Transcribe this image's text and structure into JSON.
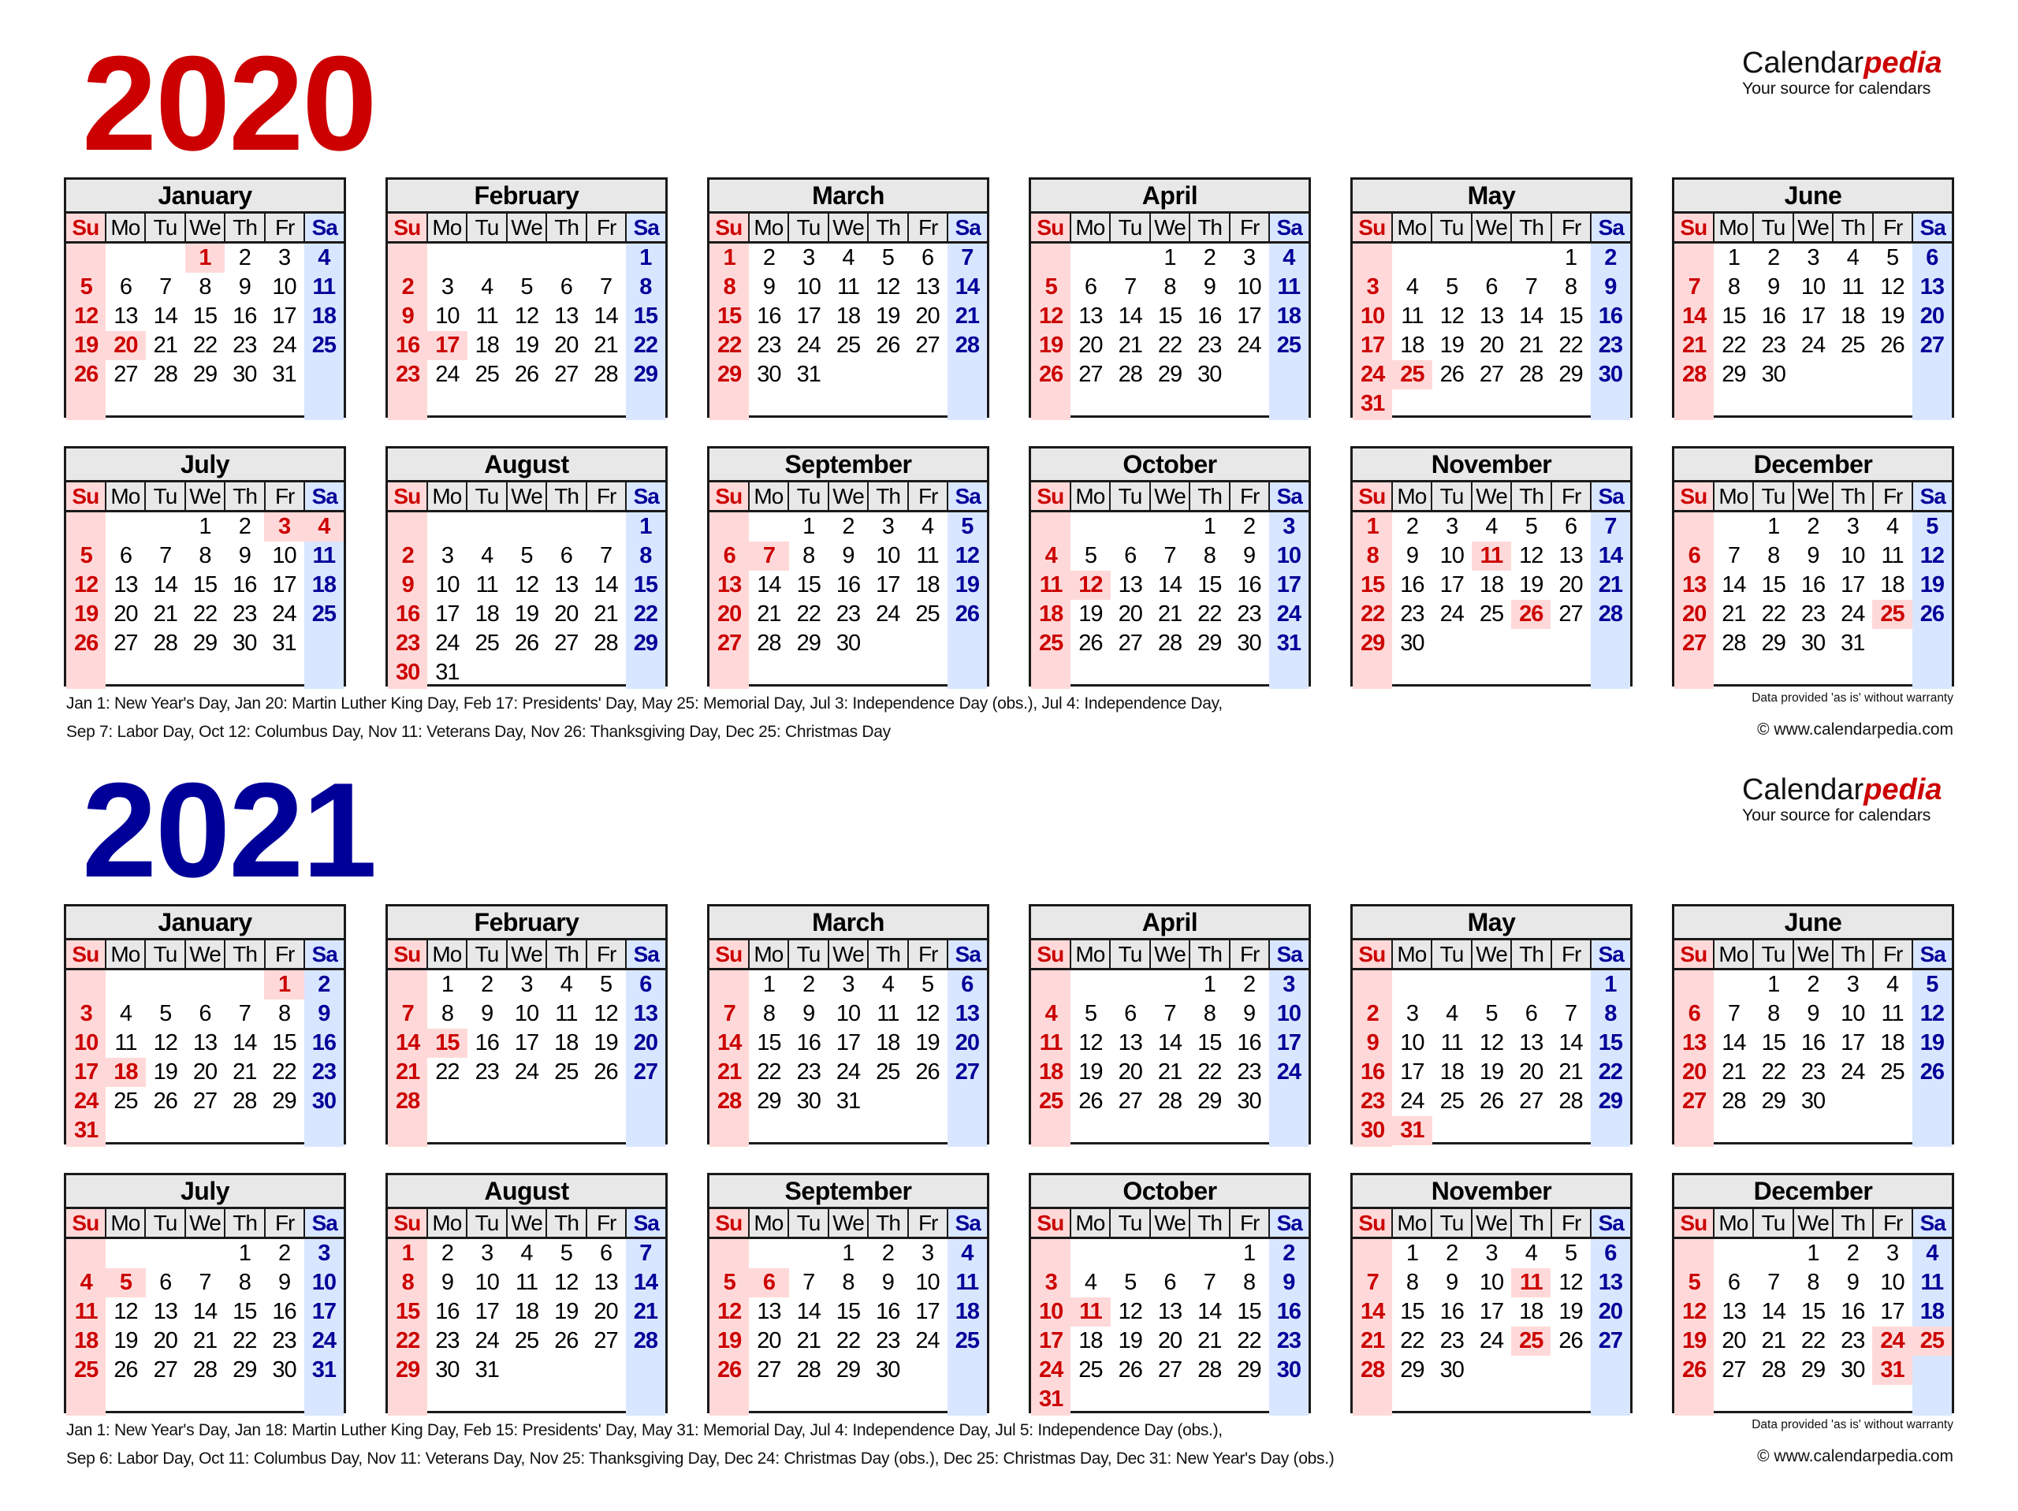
{
  "logo": {
    "brand_main": "Calendar",
    "brand_accent": "pedia",
    "tagline": "Your source for calendars"
  },
  "weekday_labels": [
    "Su",
    "Mo",
    "Tu",
    "We",
    "Th",
    "Fr",
    "Sa"
  ],
  "colors": {
    "sunday_text": "#cc0000",
    "saturday_text": "#000099",
    "holiday_bg": "#ffd9d9",
    "saturday_bg": "#d9e6ff",
    "header_bg": "#e8e8e8"
  },
  "disclaimer": "Data provided 'as is' without warranty",
  "copyright": "© www.calendarpedia.com",
  "years": [
    {
      "year": "2020",
      "color": "#cc0000",
      "holiday_notes": [
        "Jan 1: New Year's Day, Jan 20: Martin Luther King Day, Feb 17: Presidents' Day, May 25: Memorial Day, Jul 3: Independence Day (obs.), Jul 4: Independence Day,",
        "Sep 7: Labor Day, Oct 12: Columbus Day, Nov 11: Veterans Day, Nov 26: Thanksgiving Day, Dec 25: Christmas Day"
      ],
      "months": [
        {
          "name": "January",
          "first_weekday": 3,
          "days": 31,
          "holidays": [
            1,
            20
          ]
        },
        {
          "name": "February",
          "first_weekday": 6,
          "days": 29,
          "holidays": [
            17
          ]
        },
        {
          "name": "March",
          "first_weekday": 0,
          "days": 31,
          "holidays": []
        },
        {
          "name": "April",
          "first_weekday": 3,
          "days": 30,
          "holidays": []
        },
        {
          "name": "May",
          "first_weekday": 5,
          "days": 31,
          "holidays": [
            25
          ]
        },
        {
          "name": "June",
          "first_weekday": 1,
          "days": 30,
          "holidays": []
        },
        {
          "name": "July",
          "first_weekday": 3,
          "days": 31,
          "holidays": [
            3,
            4
          ]
        },
        {
          "name": "August",
          "first_weekday": 6,
          "days": 31,
          "holidays": []
        },
        {
          "name": "September",
          "first_weekday": 2,
          "days": 30,
          "holidays": [
            7
          ]
        },
        {
          "name": "October",
          "first_weekday": 4,
          "days": 31,
          "holidays": [
            12
          ]
        },
        {
          "name": "November",
          "first_weekday": 0,
          "days": 30,
          "holidays": [
            11,
            26
          ]
        },
        {
          "name": "December",
          "first_weekday": 2,
          "days": 31,
          "holidays": [
            25
          ]
        }
      ]
    },
    {
      "year": "2021",
      "color": "#000099",
      "holiday_notes": [
        "Jan 1: New Year's Day, Jan 18: Martin Luther King Day, Feb 15: Presidents' Day, May 31: Memorial Day, Jul 4: Independence Day, Jul 5: Independence Day (obs.),",
        "Sep 6: Labor Day, Oct 11: Columbus Day, Nov 11: Veterans Day, Nov 25: Thanksgiving Day, Dec 24: Christmas Day (obs.), Dec 25: Christmas Day, Dec 31: New Year's Day (obs.)"
      ],
      "months": [
        {
          "name": "January",
          "first_weekday": 5,
          "days": 31,
          "holidays": [
            1,
            18
          ]
        },
        {
          "name": "February",
          "first_weekday": 1,
          "days": 28,
          "holidays": [
            15
          ]
        },
        {
          "name": "March",
          "first_weekday": 1,
          "days": 31,
          "holidays": []
        },
        {
          "name": "April",
          "first_weekday": 4,
          "days": 30,
          "holidays": []
        },
        {
          "name": "May",
          "first_weekday": 6,
          "days": 31,
          "holidays": [
            31
          ]
        },
        {
          "name": "June",
          "first_weekday": 2,
          "days": 30,
          "holidays": []
        },
        {
          "name": "July",
          "first_weekday": 4,
          "days": 31,
          "holidays": [
            4,
            5
          ]
        },
        {
          "name": "August",
          "first_weekday": 0,
          "days": 31,
          "holidays": []
        },
        {
          "name": "September",
          "first_weekday": 3,
          "days": 30,
          "holidays": [
            6
          ]
        },
        {
          "name": "October",
          "first_weekday": 5,
          "days": 31,
          "holidays": [
            11
          ]
        },
        {
          "name": "November",
          "first_weekday": 1,
          "days": 30,
          "holidays": [
            11,
            25
          ]
        },
        {
          "name": "December",
          "first_weekday": 3,
          "days": 31,
          "holidays": [
            24,
            25,
            31
          ]
        }
      ]
    }
  ]
}
